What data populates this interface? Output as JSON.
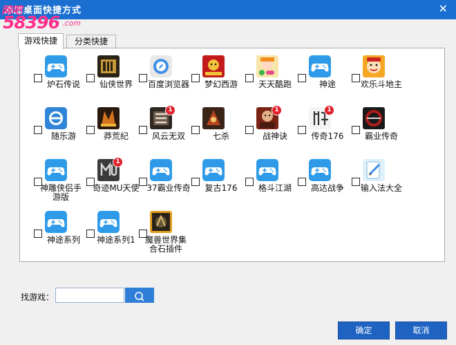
{
  "window": {
    "title": "添加桌面快捷方式",
    "close_glyph": "✕"
  },
  "watermark": {
    "top": "网吧",
    "number": "58396",
    "domain": ".com"
  },
  "tabs": [
    {
      "label": "游戏快捷",
      "active": true
    },
    {
      "label": "分类快捷",
      "active": false
    }
  ],
  "games": [
    {
      "label": "炉石传说",
      "icon": "gamepad-icon",
      "checked": false
    },
    {
      "label": "仙侠世界",
      "icon": "xianxia-icon",
      "checked": false
    },
    {
      "label": "百度浏览器",
      "icon": "baidu-browser-icon",
      "checked": false
    },
    {
      "label": "梦幻西游",
      "icon": "menghuan-icon",
      "checked": false
    },
    {
      "label": "天天酷跑",
      "icon": "kupao-icon",
      "checked": false
    },
    {
      "label": "神途",
      "icon": "gamepad-icon",
      "checked": false
    },
    {
      "label": "欢乐斗地主",
      "icon": "doudizhu-icon",
      "checked": false
    },
    {
      "label": "随乐游",
      "icon": "suileyou-icon",
      "checked": false
    },
    {
      "label": "莽荒纪",
      "icon": "manghuang-icon",
      "checked": false
    },
    {
      "label": "风云无双",
      "icon": "fengyun-icon",
      "checked": false,
      "badge": "1"
    },
    {
      "label": "七杀",
      "icon": "qisha-icon",
      "checked": false
    },
    {
      "label": "战神诀",
      "icon": "zhanshen-icon",
      "checked": false,
      "badge": "1"
    },
    {
      "label": "传奇176",
      "icon": "chuanqi-icon",
      "checked": false,
      "badge": "1"
    },
    {
      "label": "霸业传奇",
      "icon": "baye-icon",
      "checked": false
    },
    {
      "label": "神雕侠侣手游版",
      "icon": "gamepad-icon",
      "checked": false
    },
    {
      "label": "奇迹MU天使",
      "icon": "mu-icon",
      "checked": false,
      "badge": "1"
    },
    {
      "label": "37霸业传奇",
      "icon": "gamepad-icon",
      "checked": false
    },
    {
      "label": "复古176",
      "icon": "gamepad-icon",
      "checked": false
    },
    {
      "label": "格斗江湖",
      "icon": "gamepad-icon",
      "checked": false
    },
    {
      "label": "高达战争",
      "icon": "gamepad-icon",
      "checked": false
    },
    {
      "label": "输入法大全",
      "icon": "input-method-icon",
      "checked": false
    },
    {
      "label": "神途系列",
      "icon": "gamepad-icon",
      "checked": false
    },
    {
      "label": "神途系列1",
      "icon": "gamepad-icon",
      "checked": false
    },
    {
      "label": "魔兽世界集合石插件",
      "icon": "wow-icon",
      "checked": false
    }
  ],
  "search": {
    "label": "找游戏：",
    "value": "",
    "placeholder": ""
  },
  "buttons": {
    "ok": "确定",
    "cancel": "取消"
  },
  "colors": {
    "titlebar": "#1a6fd1",
    "gamepad_bg": "#2f9be8",
    "button": "#1e63c2",
    "badge": "#e0202a",
    "watermark": "#ff2f8b"
  }
}
